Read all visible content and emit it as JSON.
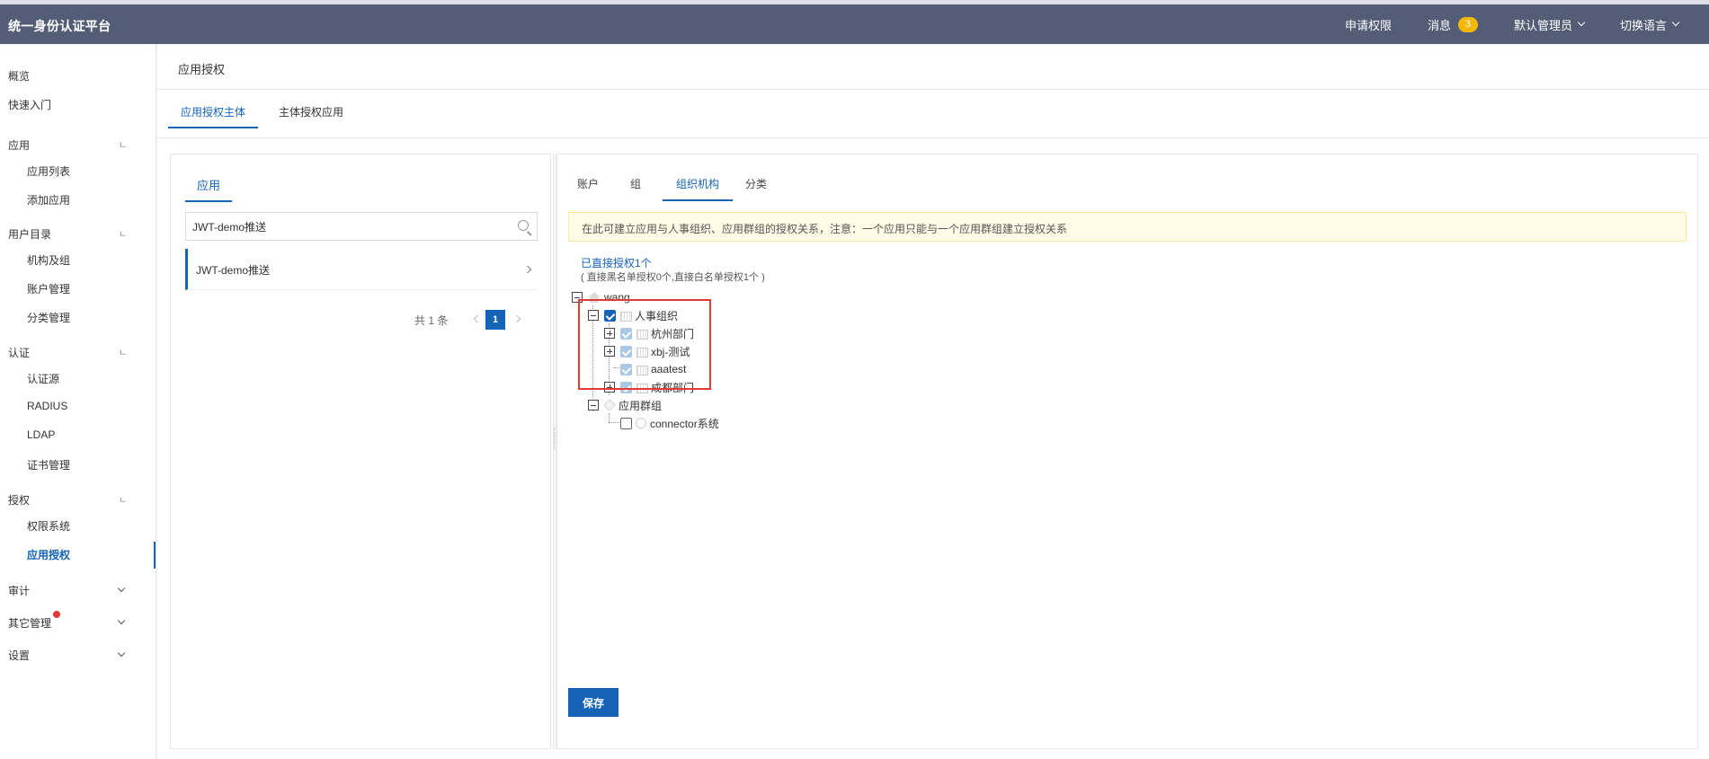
{
  "header": {
    "brand": "统一身份认证平台",
    "apply_permission": "申请权限",
    "messages_label": "消息",
    "messages_count": "3",
    "user_label": "默认管理员",
    "language_label": "切换语言"
  },
  "sidebar": {
    "overview": "概览",
    "quick_start": "快速入门",
    "app_group": "应用",
    "app_list": "应用列表",
    "add_app": "添加应用",
    "directory_group": "用户目录",
    "org_group": "机构及组",
    "account_mgmt": "账户管理",
    "category_mgmt": "分类管理",
    "auth_group": "认证",
    "auth_source": "认证源",
    "radius": "RADIUS",
    "ldap": "LDAP",
    "cert_mgmt": "证书管理",
    "authorization_group": "授权",
    "permission_system": "权限系统",
    "app_authorization": "应用授权",
    "audit_group": "审计",
    "other_mgmt_group": "其它管理",
    "settings_group": "设置",
    "collapse_mark": "ㄴ"
  },
  "page": {
    "title": "应用授权",
    "tabs": [
      "应用授权主体",
      "主体授权应用"
    ],
    "left": {
      "tab": "应用",
      "search_value": "JWT-demo推送",
      "items": [
        "JWT-demo推送"
      ],
      "pager_total": "共 1 条",
      "pager_current": "1"
    },
    "right": {
      "tabs": [
        "账户",
        "组",
        "组织机构",
        "分类"
      ],
      "notice": "在此可建立应用与人事组织、应用群组的授权关系，注意：一个应用只能与一个应用群组建立授权关系",
      "stat_link": "已直接授权1个",
      "stat_detail": "( 直接黑名单授权0个,直接白名单授权1个 )",
      "tree": {
        "root": "wang",
        "org": "人事组织",
        "org_children": [
          "杭州部门",
          "xbj-测试",
          "aaatest",
          "成都部门"
        ],
        "group": "应用群组",
        "group_children": [
          "connector系统"
        ]
      },
      "save_button": "保存"
    }
  },
  "colors": {
    "header_bg": "#535e76",
    "primary": "#1463b7",
    "badge": "#f5b800",
    "highlight": "#e53935"
  }
}
